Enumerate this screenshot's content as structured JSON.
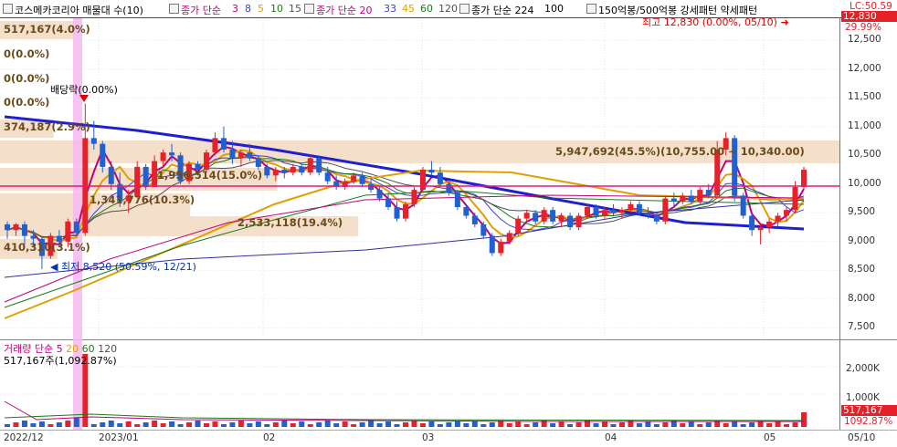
{
  "toolbar": {
    "items": [
      {
        "label": "코스메카코리아 매물대 수(10)",
        "color": "#000000"
      },
      {
        "label": "종가 단순",
        "color": "#c0007a"
      },
      {
        "label": "3",
        "color": "#c0007a"
      },
      {
        "label": "8",
        "color": "#4040d0"
      },
      {
        "label": "5",
        "color": "#e0a000"
      },
      {
        "label": "10",
        "color": "#1a7a1a"
      },
      {
        "label": "15",
        "color": "#505050"
      },
      {
        "label": "종가 단순 20",
        "color": "#c0007a"
      },
      {
        "label": "33",
        "color": "#4040d0"
      },
      {
        "label": "45",
        "color": "#e0a000"
      },
      {
        "label": "60",
        "color": "#1a7a1a"
      },
      {
        "label": "120",
        "color": "#505050"
      },
      {
        "label": "종가 단순 224",
        "color": "#000000"
      },
      {
        "label": "100",
        "color": "#000000"
      },
      {
        "label": "150억봉/500억봉 강세패턴  약세패턴",
        "color": "#000000"
      }
    ]
  },
  "price_axis": {
    "ticks": [
      "12,500",
      "12,000",
      "11,500",
      "11,000",
      "10,500",
      "10,000",
      "9,500",
      "9,000",
      "8,500",
      "8,000",
      "7,500"
    ],
    "current_price": "12,830",
    "current_pct": "29.99%",
    "top_label": "LC:50.59"
  },
  "annotations": {
    "high": "최고 12,830 (0.00%, 05/10)",
    "low": "최저 8,520 (50.59%, 12/21)",
    "dividend": "배당락(0.00%)"
  },
  "volume_profile": [
    {
      "label": "517,167(4.0%)",
      "value": 517167,
      "pct": 4.0
    },
    {
      "label": "0(0.0%)",
      "value": 0,
      "pct": 0.0
    },
    {
      "label": "0(0.0%)",
      "value": 0,
      "pct": 0.0
    },
    {
      "label": "0(0.0%)",
      "value": 0,
      "pct": 0.0
    },
    {
      "label": "374,187(2.9%)",
      "value": 374187,
      "pct": 2.9
    },
    {
      "label": "5,947,692(45.5%)(10,755.00 ~ 10,340.00)",
      "value": 5947692,
      "pct": 45.5
    },
    {
      "label": "1,956,514(15.0%)",
      "value": 1956514,
      "pct": 15.0
    },
    {
      "label": "1,341,776(10.3%)",
      "value": 1341776,
      "pct": 10.3
    },
    {
      "label": "2,533,118(19.4%)",
      "value": 2533118,
      "pct": 19.4
    },
    {
      "label": "410,310(3.1%)",
      "value": 410310,
      "pct": 3.1
    }
  ],
  "volume_panel": {
    "title": "거래량",
    "ma_label": "단순",
    "ma_periods": [
      "5",
      "20",
      "60",
      "120"
    ],
    "current": "517,167주(1,092.87%)",
    "axis_ticks": [
      "2,000K",
      "1,000K"
    ],
    "badge_value": "517,167",
    "badge_pct": "1092.87%"
  },
  "date_axis": [
    "2022/12",
    "2023/01",
    "02",
    "03",
    "04",
    "05",
    "05/10"
  ],
  "colors": {
    "up": "#e8202a",
    "down": "#2060d0",
    "profile": "#f2dcc4",
    "hline": "#e0197d"
  },
  "chart_data": {
    "type": "candlestick",
    "title": "코스메카코리아",
    "ylim": [
      7300,
      12900
    ],
    "x_categories": [
      "2022/12",
      "2023/01",
      "02",
      "03",
      "04",
      "05"
    ],
    "candles": [
      [
        9300,
        9350,
        9050,
        9200
      ],
      [
        9200,
        9320,
        9100,
        9300
      ],
      [
        9300,
        9350,
        8950,
        9100
      ],
      [
        9100,
        9200,
        8900,
        9050
      ],
      [
        9050,
        9100,
        8520,
        8750
      ],
      [
        8750,
        9150,
        8700,
        9100
      ],
      [
        9100,
        9200,
        8900,
        9000
      ],
      [
        9000,
        9400,
        8900,
        9350
      ],
      [
        9350,
        9400,
        9100,
        9150
      ],
      [
        9150,
        11400,
        9100,
        10800
      ],
      [
        10800,
        11100,
        10600,
        10700
      ],
      [
        10700,
        10750,
        10200,
        10300
      ],
      [
        10300,
        10400,
        9900,
        10000
      ],
      [
        10000,
        10200,
        9600,
        9700
      ],
      [
        9700,
        9900,
        9500,
        9800
      ],
      [
        9800,
        10400,
        9750,
        10300
      ],
      [
        10300,
        10350,
        9900,
        9950
      ],
      [
        9950,
        10500,
        9950,
        10400
      ],
      [
        10400,
        10600,
        10300,
        10550
      ],
      [
        10550,
        10700,
        10400,
        10500
      ],
      [
        10500,
        10550,
        10000,
        10050
      ],
      [
        10050,
        10400,
        10000,
        10350
      ],
      [
        10350,
        10400,
        10150,
        10250
      ],
      [
        10250,
        10600,
        10200,
        10550
      ],
      [
        10550,
        10900,
        10500,
        10800
      ],
      [
        10800,
        11000,
        10550,
        10600
      ],
      [
        10600,
        10750,
        10350,
        10450
      ],
      [
        10450,
        10600,
        10300,
        10550
      ],
      [
        10550,
        10700,
        10400,
        10450
      ],
      [
        10450,
        10500,
        10250,
        10300
      ],
      [
        10300,
        10350,
        10100,
        10150
      ],
      [
        10150,
        10300,
        10050,
        10250
      ],
      [
        10250,
        10300,
        10100,
        10200
      ],
      [
        10200,
        10350,
        10150,
        10300
      ],
      [
        10300,
        10350,
        10150,
        10200
      ],
      [
        10200,
        10500,
        10150,
        10450
      ],
      [
        10450,
        10500,
        10150,
        10200
      ],
      [
        10200,
        10300,
        10000,
        10050
      ],
      [
        10050,
        10150,
        9900,
        9950
      ],
      [
        9950,
        10100,
        9900,
        10050
      ],
      [
        10050,
        10200,
        10000,
        10150
      ],
      [
        10150,
        10200,
        9950,
        10000
      ],
      [
        10000,
        10100,
        9850,
        9900
      ],
      [
        9900,
        9950,
        9700,
        9750
      ],
      [
        9750,
        9850,
        9550,
        9600
      ],
      [
        9600,
        9700,
        9350,
        9400
      ],
      [
        9400,
        9700,
        9350,
        9650
      ],
      [
        9650,
        9950,
        9600,
        9900
      ],
      [
        9900,
        10300,
        9850,
        10250
      ],
      [
        10250,
        10400,
        10150,
        10200
      ],
      [
        10200,
        10300,
        9950,
        10000
      ],
      [
        10000,
        10050,
        9800,
        9850
      ],
      [
        9850,
        9900,
        9550,
        9600
      ],
      [
        9600,
        9650,
        9400,
        9450
      ],
      [
        9450,
        9500,
        9250,
        9300
      ],
      [
        9300,
        9350,
        9050,
        9100
      ],
      [
        9100,
        9150,
        8750,
        8800
      ],
      [
        8800,
        9050,
        8750,
        9000
      ],
      [
        9000,
        9200,
        8950,
        9150
      ],
      [
        9150,
        9450,
        9100,
        9400
      ],
      [
        9400,
        9550,
        9350,
        9500
      ],
      [
        9500,
        9550,
        9300,
        9350
      ],
      [
        9350,
        9600,
        9300,
        9550
      ],
      [
        9550,
        9600,
        9300,
        9350
      ],
      [
        9350,
        9500,
        9250,
        9450
      ],
      [
        9450,
        9500,
        9200,
        9250
      ],
      [
        9250,
        9500,
        9200,
        9450
      ],
      [
        9450,
        9650,
        9400,
        9600
      ],
      [
        9600,
        9650,
        9400,
        9450
      ],
      [
        9450,
        9600,
        9400,
        9550
      ],
      [
        9550,
        9650,
        9450,
        9500
      ],
      [
        9500,
        9600,
        9400,
        9550
      ],
      [
        9550,
        9700,
        9500,
        9650
      ],
      [
        9650,
        9700,
        9450,
        9500
      ],
      [
        9500,
        9600,
        9400,
        9450
      ],
      [
        9450,
        9500,
        9300,
        9350
      ],
      [
        9350,
        9800,
        9300,
        9750
      ],
      [
        9750,
        9850,
        9600,
        9700
      ],
      [
        9700,
        9850,
        9650,
        9800
      ],
      [
        9800,
        9900,
        9650,
        9700
      ],
      [
        9700,
        9950,
        9650,
        9900
      ],
      [
        9900,
        10000,
        9750,
        9800
      ],
      [
        9800,
        10750,
        9750,
        10600
      ],
      [
        10600,
        10900,
        10500,
        10800
      ],
      [
        10800,
        10850,
        9700,
        9800
      ],
      [
        9800,
        9850,
        9400,
        9450
      ],
      [
        9450,
        9500,
        9100,
        9200
      ],
      [
        9200,
        9300,
        8950,
        9250
      ],
      [
        9250,
        9400,
        9150,
        9350
      ],
      [
        9350,
        9500,
        9250,
        9450
      ],
      [
        9450,
        9600,
        9350,
        9550
      ],
      [
        9550,
        10050,
        9500,
        9950
      ],
      [
        9950,
        10300,
        9900,
        10250
      ]
    ]
  }
}
